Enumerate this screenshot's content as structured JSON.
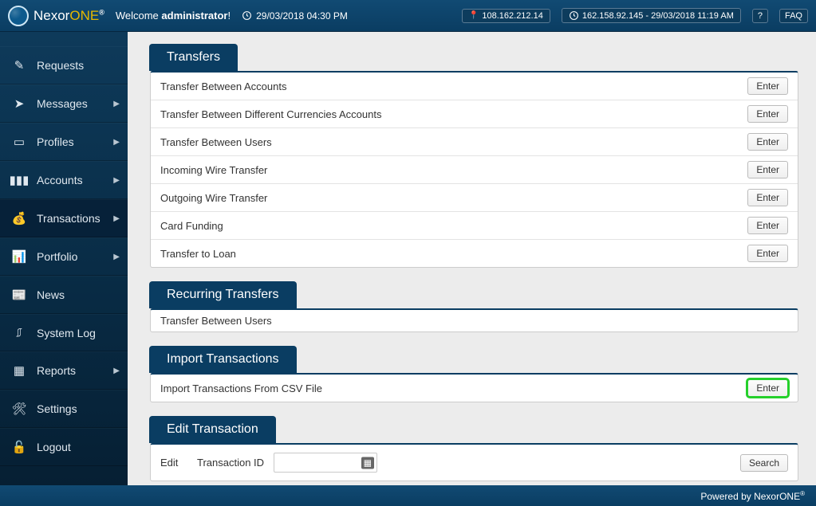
{
  "header": {
    "brand_main": "Nexor",
    "brand_accent": "ONE",
    "brand_reg": "®",
    "welcome_prefix": "Welcome ",
    "welcome_user": "administrator",
    "welcome_suffix": "!",
    "datetime": "29/03/2018 04:30 PM",
    "ip_current": "108.162.212.14",
    "ip_previous": "162.158.92.145 - 29/03/2018 11:19 AM",
    "help_label": "?",
    "faq_label": "FAQ"
  },
  "sidebar": {
    "items": [
      {
        "icon": "request-icon",
        "glyph": "✎",
        "label": "Requests",
        "submenu": false
      },
      {
        "icon": "messages-icon",
        "glyph": "➤",
        "label": "Messages",
        "submenu": true
      },
      {
        "icon": "profiles-icon",
        "glyph": "▭",
        "label": "Profiles",
        "submenu": true
      },
      {
        "icon": "accounts-icon",
        "glyph": "▮▮▮",
        "label": "Accounts",
        "submenu": true
      },
      {
        "icon": "transactions-icon",
        "glyph": "💰",
        "label": "Transactions",
        "submenu": true,
        "active": true
      },
      {
        "icon": "portfolio-icon",
        "glyph": "📊",
        "label": "Portfolio",
        "submenu": true
      },
      {
        "icon": "news-icon",
        "glyph": "📰",
        "label": "News",
        "submenu": false
      },
      {
        "icon": "systemlog-icon",
        "glyph": "⎎",
        "label": "System Log",
        "submenu": false
      },
      {
        "icon": "reports-icon",
        "glyph": "▦",
        "label": "Reports",
        "submenu": true
      },
      {
        "icon": "settings-icon",
        "glyph": "🛠",
        "label": "Settings",
        "submenu": false
      },
      {
        "icon": "logout-icon",
        "glyph": "🔓",
        "label": "Logout",
        "submenu": false
      }
    ]
  },
  "sections": {
    "transfers": {
      "title": "Transfers",
      "rows": [
        {
          "label": "Transfer Between Accounts",
          "button": "Enter"
        },
        {
          "label": "Transfer Between Different Currencies Accounts",
          "button": "Enter"
        },
        {
          "label": "Transfer Between Users",
          "button": "Enter"
        },
        {
          "label": "Incoming Wire Transfer",
          "button": "Enter"
        },
        {
          "label": "Outgoing Wire Transfer",
          "button": "Enter"
        },
        {
          "label": "Card Funding",
          "button": "Enter"
        },
        {
          "label": "Transfer to Loan",
          "button": "Enter"
        }
      ]
    },
    "recurring": {
      "title": "Recurring Transfers",
      "rows": [
        {
          "label": "Transfer Between Users"
        }
      ]
    },
    "import": {
      "title": "Import Transactions",
      "rows": [
        {
          "label": "Import Transactions From CSV File",
          "button": "Enter",
          "highlight": true
        }
      ]
    },
    "edit": {
      "title": "Edit Transaction",
      "edit_label": "Edit",
      "field_label": "Transaction ID",
      "field_value": "",
      "search_button": "Search"
    }
  },
  "footer": {
    "powered_prefix": "Powered by ",
    "powered_brand": "NexorONE",
    "powered_reg": "®"
  }
}
